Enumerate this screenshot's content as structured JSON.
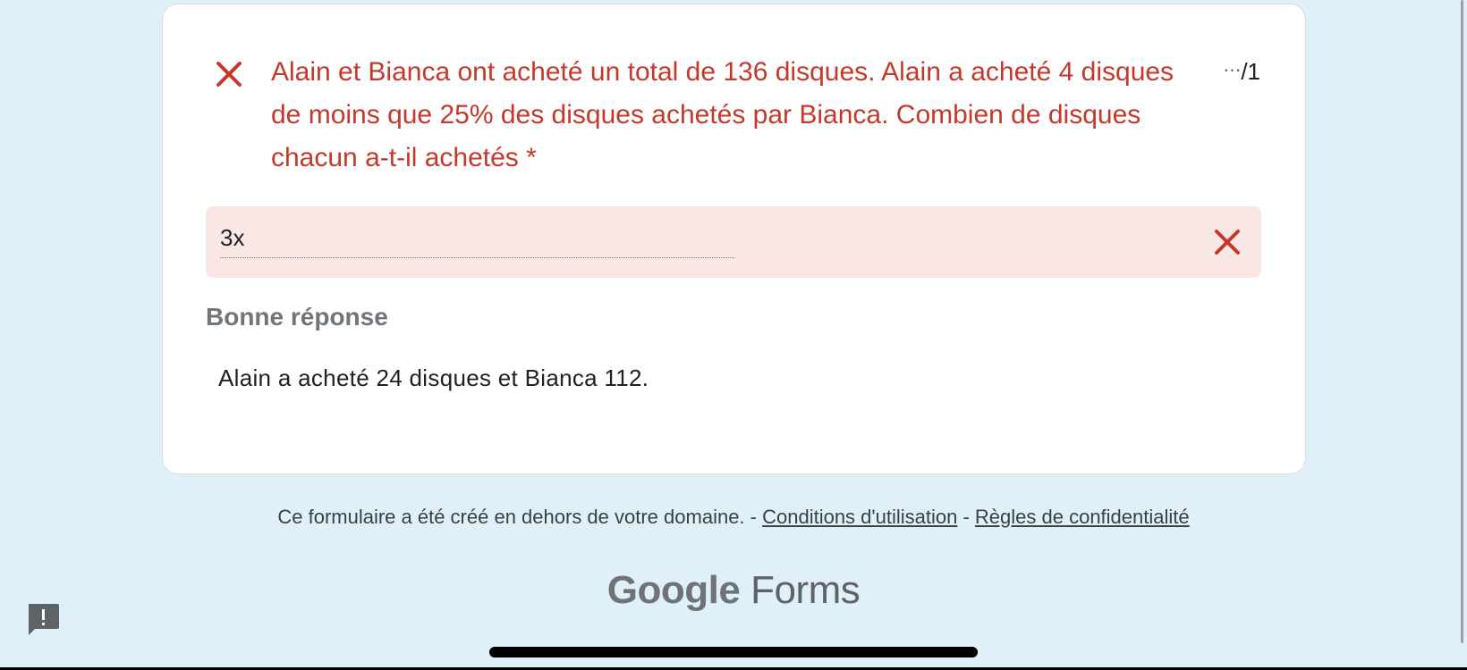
{
  "question": {
    "text": "Alain et Bianca ont acheté un total de 136 disques. Alain a acheté 4 disques de moins que 25% des disques achetés par Bianca. Combien de disques chacun a-t-il achetés *",
    "points_dots": "⋯",
    "points": "/1",
    "status_icon": "close-icon",
    "status_color": "#c5392c"
  },
  "answer": {
    "value": "3x",
    "result_icon": "close-icon"
  },
  "feedback": {
    "label": "Bonne réponse",
    "correct_answer": "Alain a acheté 24 disques et Bianca 112."
  },
  "footer": {
    "note": "Ce formulaire a été créé en dehors de votre domaine. -",
    "terms_link": "Conditions d'utilisation",
    "separator": "-",
    "privacy_link": "Règles de confidentialité"
  },
  "brand": {
    "google": "Google",
    "forms": "Forms"
  }
}
